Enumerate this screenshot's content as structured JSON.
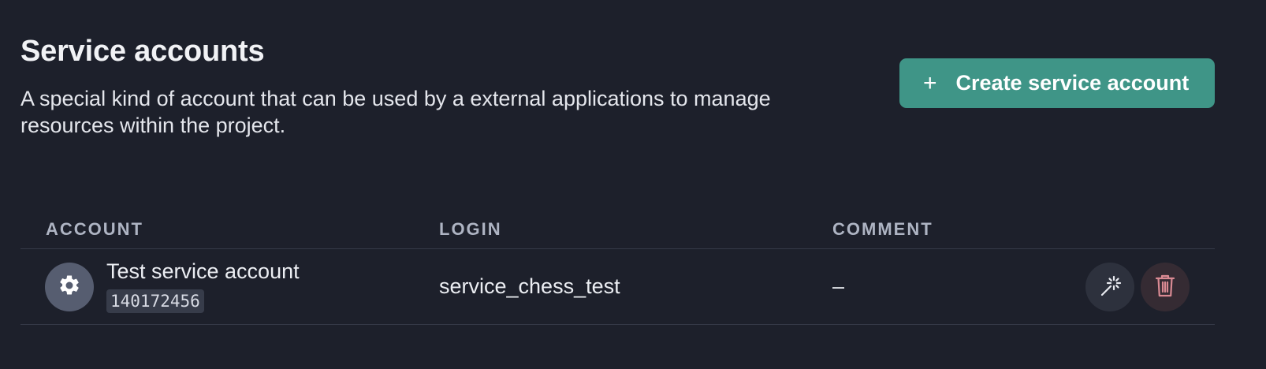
{
  "header": {
    "title": "Service accounts",
    "description": "A special kind of account that can be used by a external applications to manage resources within the project.",
    "create_button": {
      "icon": "plus-icon",
      "label": "Create service account"
    }
  },
  "table": {
    "columns": [
      "ACCOUNT",
      "LOGIN",
      "COMMENT"
    ],
    "rows": [
      {
        "avatar_icon": "gear-icon",
        "account_name": "Test service account",
        "account_id": "140172456",
        "login": "service_chess_test",
        "comment": "–",
        "actions": [
          "magic-wand-icon",
          "trash-icon"
        ]
      }
    ]
  },
  "colors": {
    "background": "#1d202b",
    "accent": "#3f9587",
    "danger": "#d98a93",
    "muted": "#aeb4c3"
  }
}
